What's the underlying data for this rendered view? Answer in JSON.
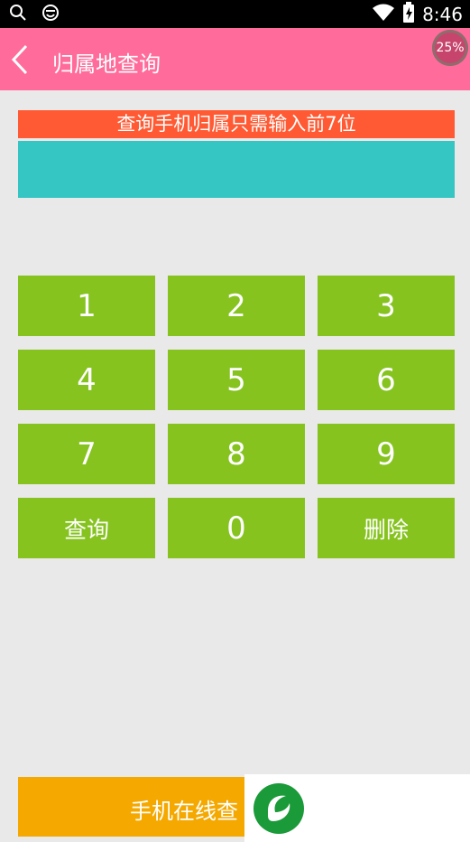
{
  "status_bar": {
    "time": "8:46"
  },
  "app_bar": {
    "title": "归属地查询",
    "progress_badge": "25%"
  },
  "hint": {
    "text": "查询手机归属只需输入前7位"
  },
  "display": {
    "value": ""
  },
  "keypad": {
    "keys": [
      "1",
      "2",
      "3",
      "4",
      "5",
      "6",
      "7",
      "8",
      "9",
      "查询",
      "0",
      "删除"
    ]
  },
  "bottom_bar": {
    "label": "手机在线查"
  },
  "colors": {
    "app_bar": "#ff6c9b",
    "hint_bar": "#ff5a33",
    "display_bar": "#35c6c3",
    "key_bg": "#86c31f",
    "bottom_bar": "#f4a800"
  },
  "icons": [
    "search-icon",
    "smiley-icon",
    "wifi-icon",
    "battery-charging-icon",
    "back-arrow-icon",
    "app-logo-icon"
  ]
}
